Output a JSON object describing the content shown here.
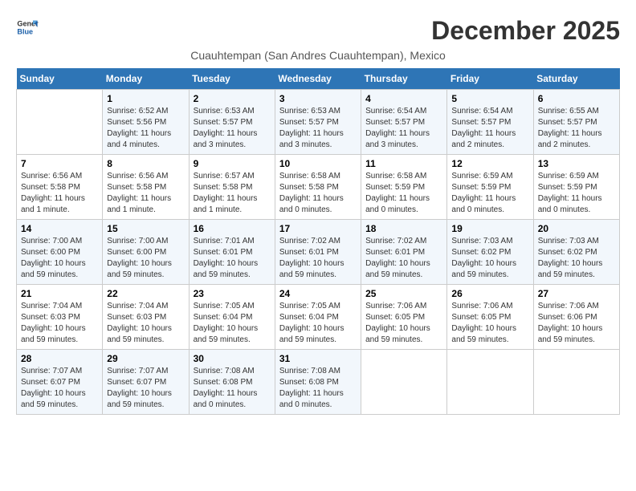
{
  "logo": {
    "line1": "General",
    "line2": "Blue"
  },
  "title": "December 2025",
  "subtitle": "Cuauhtempan (San Andres Cuauhtempan), Mexico",
  "days_of_week": [
    "Sunday",
    "Monday",
    "Tuesday",
    "Wednesday",
    "Thursday",
    "Friday",
    "Saturday"
  ],
  "weeks": [
    [
      {
        "day": "",
        "sunrise": "",
        "sunset": "",
        "daylight": ""
      },
      {
        "day": "1",
        "sunrise": "Sunrise: 6:52 AM",
        "sunset": "Sunset: 5:56 PM",
        "daylight": "Daylight: 11 hours and 4 minutes."
      },
      {
        "day": "2",
        "sunrise": "Sunrise: 6:53 AM",
        "sunset": "Sunset: 5:57 PM",
        "daylight": "Daylight: 11 hours and 3 minutes."
      },
      {
        "day": "3",
        "sunrise": "Sunrise: 6:53 AM",
        "sunset": "Sunset: 5:57 PM",
        "daylight": "Daylight: 11 hours and 3 minutes."
      },
      {
        "day": "4",
        "sunrise": "Sunrise: 6:54 AM",
        "sunset": "Sunset: 5:57 PM",
        "daylight": "Daylight: 11 hours and 3 minutes."
      },
      {
        "day": "5",
        "sunrise": "Sunrise: 6:54 AM",
        "sunset": "Sunset: 5:57 PM",
        "daylight": "Daylight: 11 hours and 2 minutes."
      },
      {
        "day": "6",
        "sunrise": "Sunrise: 6:55 AM",
        "sunset": "Sunset: 5:57 PM",
        "daylight": "Daylight: 11 hours and 2 minutes."
      }
    ],
    [
      {
        "day": "7",
        "sunrise": "Sunrise: 6:56 AM",
        "sunset": "Sunset: 5:58 PM",
        "daylight": "Daylight: 11 hours and 1 minute."
      },
      {
        "day": "8",
        "sunrise": "Sunrise: 6:56 AM",
        "sunset": "Sunset: 5:58 PM",
        "daylight": "Daylight: 11 hours and 1 minute."
      },
      {
        "day": "9",
        "sunrise": "Sunrise: 6:57 AM",
        "sunset": "Sunset: 5:58 PM",
        "daylight": "Daylight: 11 hours and 1 minute."
      },
      {
        "day": "10",
        "sunrise": "Sunrise: 6:58 AM",
        "sunset": "Sunset: 5:58 PM",
        "daylight": "Daylight: 11 hours and 0 minutes."
      },
      {
        "day": "11",
        "sunrise": "Sunrise: 6:58 AM",
        "sunset": "Sunset: 5:59 PM",
        "daylight": "Daylight: 11 hours and 0 minutes."
      },
      {
        "day": "12",
        "sunrise": "Sunrise: 6:59 AM",
        "sunset": "Sunset: 5:59 PM",
        "daylight": "Daylight: 11 hours and 0 minutes."
      },
      {
        "day": "13",
        "sunrise": "Sunrise: 6:59 AM",
        "sunset": "Sunset: 5:59 PM",
        "daylight": "Daylight: 11 hours and 0 minutes."
      }
    ],
    [
      {
        "day": "14",
        "sunrise": "Sunrise: 7:00 AM",
        "sunset": "Sunset: 6:00 PM",
        "daylight": "Daylight: 10 hours and 59 minutes."
      },
      {
        "day": "15",
        "sunrise": "Sunrise: 7:00 AM",
        "sunset": "Sunset: 6:00 PM",
        "daylight": "Daylight: 10 hours and 59 minutes."
      },
      {
        "day": "16",
        "sunrise": "Sunrise: 7:01 AM",
        "sunset": "Sunset: 6:01 PM",
        "daylight": "Daylight: 10 hours and 59 minutes."
      },
      {
        "day": "17",
        "sunrise": "Sunrise: 7:02 AM",
        "sunset": "Sunset: 6:01 PM",
        "daylight": "Daylight: 10 hours and 59 minutes."
      },
      {
        "day": "18",
        "sunrise": "Sunrise: 7:02 AM",
        "sunset": "Sunset: 6:01 PM",
        "daylight": "Daylight: 10 hours and 59 minutes."
      },
      {
        "day": "19",
        "sunrise": "Sunrise: 7:03 AM",
        "sunset": "Sunset: 6:02 PM",
        "daylight": "Daylight: 10 hours and 59 minutes."
      },
      {
        "day": "20",
        "sunrise": "Sunrise: 7:03 AM",
        "sunset": "Sunset: 6:02 PM",
        "daylight": "Daylight: 10 hours and 59 minutes."
      }
    ],
    [
      {
        "day": "21",
        "sunrise": "Sunrise: 7:04 AM",
        "sunset": "Sunset: 6:03 PM",
        "daylight": "Daylight: 10 hours and 59 minutes."
      },
      {
        "day": "22",
        "sunrise": "Sunrise: 7:04 AM",
        "sunset": "Sunset: 6:03 PM",
        "daylight": "Daylight: 10 hours and 59 minutes."
      },
      {
        "day": "23",
        "sunrise": "Sunrise: 7:05 AM",
        "sunset": "Sunset: 6:04 PM",
        "daylight": "Daylight: 10 hours and 59 minutes."
      },
      {
        "day": "24",
        "sunrise": "Sunrise: 7:05 AM",
        "sunset": "Sunset: 6:04 PM",
        "daylight": "Daylight: 10 hours and 59 minutes."
      },
      {
        "day": "25",
        "sunrise": "Sunrise: 7:06 AM",
        "sunset": "Sunset: 6:05 PM",
        "daylight": "Daylight: 10 hours and 59 minutes."
      },
      {
        "day": "26",
        "sunrise": "Sunrise: 7:06 AM",
        "sunset": "Sunset: 6:05 PM",
        "daylight": "Daylight: 10 hours and 59 minutes."
      },
      {
        "day": "27",
        "sunrise": "Sunrise: 7:06 AM",
        "sunset": "Sunset: 6:06 PM",
        "daylight": "Daylight: 10 hours and 59 minutes."
      }
    ],
    [
      {
        "day": "28",
        "sunrise": "Sunrise: 7:07 AM",
        "sunset": "Sunset: 6:07 PM",
        "daylight": "Daylight: 10 hours and 59 minutes."
      },
      {
        "day": "29",
        "sunrise": "Sunrise: 7:07 AM",
        "sunset": "Sunset: 6:07 PM",
        "daylight": "Daylight: 10 hours and 59 minutes."
      },
      {
        "day": "30",
        "sunrise": "Sunrise: 7:08 AM",
        "sunset": "Sunset: 6:08 PM",
        "daylight": "Daylight: 11 hours and 0 minutes."
      },
      {
        "day": "31",
        "sunrise": "Sunrise: 7:08 AM",
        "sunset": "Sunset: 6:08 PM",
        "daylight": "Daylight: 11 hours and 0 minutes."
      },
      {
        "day": "",
        "sunrise": "",
        "sunset": "",
        "daylight": ""
      },
      {
        "day": "",
        "sunrise": "",
        "sunset": "",
        "daylight": ""
      },
      {
        "day": "",
        "sunrise": "",
        "sunset": "",
        "daylight": ""
      }
    ]
  ]
}
